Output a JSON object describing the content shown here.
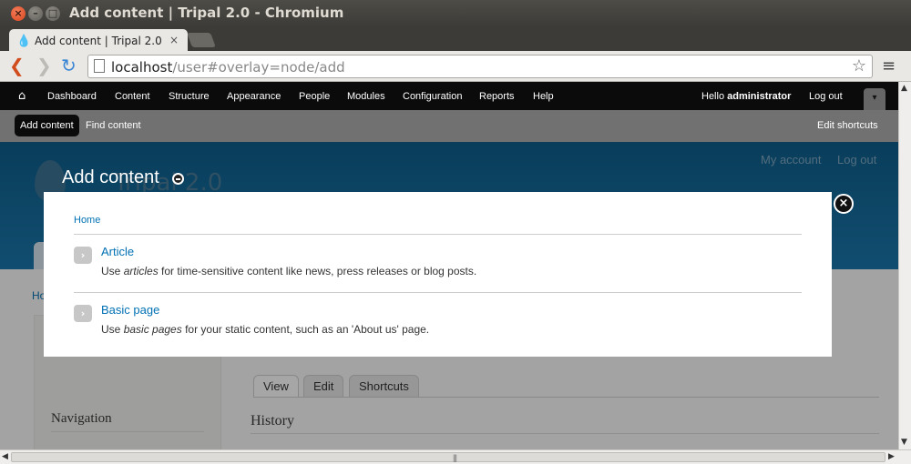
{
  "window": {
    "title": "Add content | Tripal 2.0 - Chromium",
    "close_glyph": "×",
    "min_glyph": "–",
    "max_glyph": "□"
  },
  "browser": {
    "tab_title": "Add content | Tripal 2.0",
    "tab_close": "×",
    "url_host": "localhost",
    "url_path": "/user#overlay=node/add",
    "icons": {
      "back": "❮",
      "forward": "❯",
      "reload": "↻",
      "star": "☆",
      "menu": "≡",
      "favicon": "💧"
    }
  },
  "admin_toolbar": {
    "home_glyph": "⌂",
    "menu": [
      "Dashboard",
      "Content",
      "Structure",
      "Appearance",
      "People",
      "Modules",
      "Configuration",
      "Reports",
      "Help"
    ],
    "hello_prefix": "Hello ",
    "user": "administrator",
    "logout": "Log out",
    "drawer_glyph": "▾"
  },
  "shortcuts": {
    "active": "Add content",
    "find": "Find content",
    "edit": "Edit shortcuts"
  },
  "site": {
    "name": "Tripal 2.0",
    "secondary_links": [
      "My account",
      "Log out"
    ],
    "breadcrumb": "Ho",
    "sidebar_title": "Navigation",
    "tabs": [
      "View",
      "Edit",
      "Shortcuts"
    ],
    "history_heading": "History"
  },
  "overlay": {
    "title": "Add content",
    "close_glyph": "×",
    "breadcrumb": "Home",
    "content_types": [
      {
        "title": "Article",
        "desc_prefix": "Use ",
        "desc_em": "articles",
        "desc_suffix": " for time-sensitive content like news, press releases or blog posts."
      },
      {
        "title": "Basic page",
        "desc_prefix": "Use ",
        "desc_em": "basic pages",
        "desc_suffix": " for your static content, such as an 'About us' page."
      }
    ],
    "arrow_glyph": "›"
  },
  "scrollbars": {
    "up": "▲",
    "down": "▼",
    "left": "◀",
    "right": "▶",
    "grip": "|||"
  }
}
